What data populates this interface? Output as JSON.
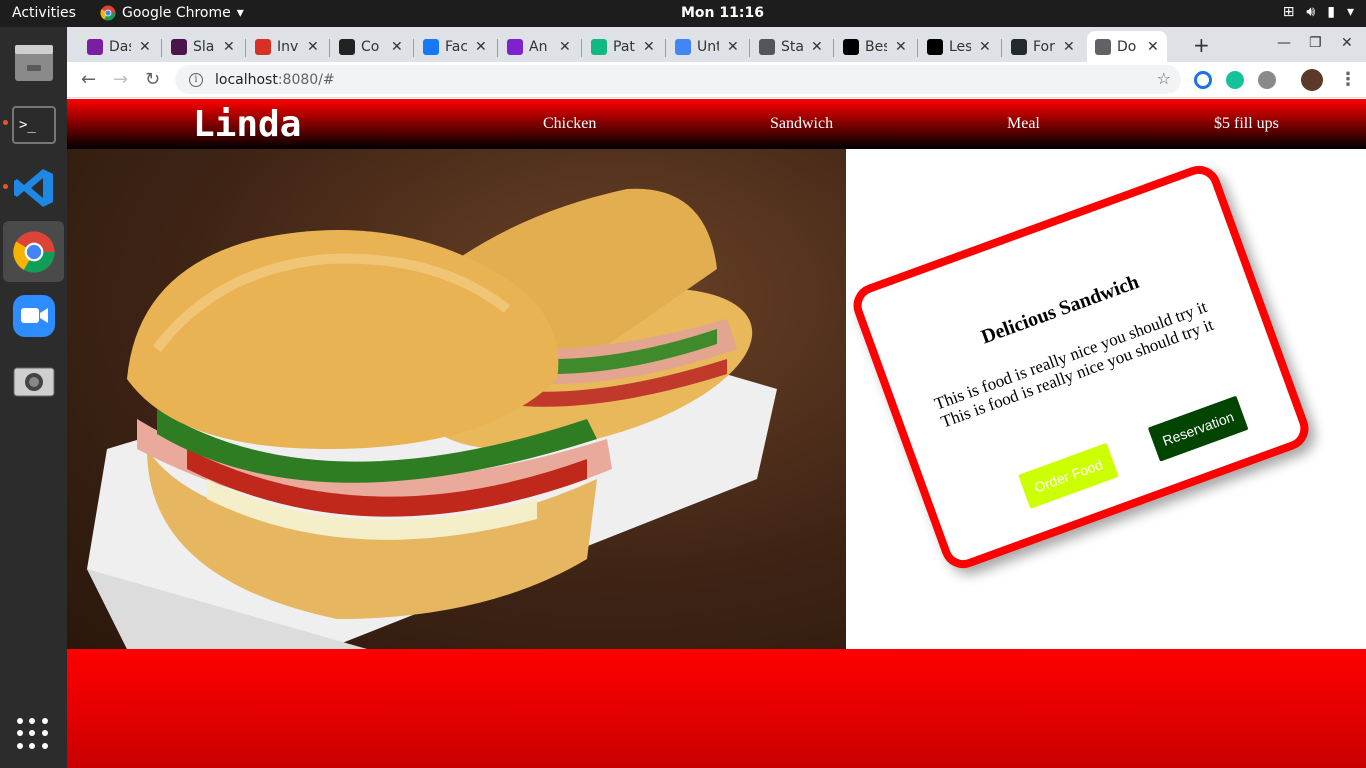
{
  "system": {
    "activities": "Activities",
    "app_name": "Google Chrome",
    "clock": "Mon 11:16"
  },
  "browser": {
    "tabs": [
      {
        "label": "Das",
        "icon": "purple-logo-icon",
        "color": "#7b1fa2"
      },
      {
        "label": "Sla",
        "icon": "slack-icon",
        "color": "#4a154b"
      },
      {
        "label": "Inv",
        "icon": "gmail-icon",
        "color": "#d93025"
      },
      {
        "label": "Co",
        "icon": "codecademy-icon",
        "color": "#222222"
      },
      {
        "label": "Fac",
        "icon": "facebook-icon",
        "color": "#1877f2"
      },
      {
        "label": "An",
        "icon": "django-icon",
        "color": "#7e22ce"
      },
      {
        "label": "Pat",
        "icon": "shield-icon",
        "color": "#10b981"
      },
      {
        "label": "Unt",
        "icon": "docs-icon",
        "color": "#4285f4"
      },
      {
        "label": "Sta",
        "icon": "peace-hand-icon",
        "color": "#555555"
      },
      {
        "label": "Bes",
        "icon": "medium-icon",
        "color": "#000000"
      },
      {
        "label": "Les",
        "icon": "medium-icon",
        "color": "#000000"
      },
      {
        "label": "For",
        "icon": "github-icon",
        "color": "#24292e"
      },
      {
        "label": "Do",
        "icon": "globe-icon",
        "color": "#5f6368",
        "active": true
      }
    ],
    "url_host": "localhost",
    "url_rest": ":8080/#"
  },
  "site": {
    "brand": "Linda",
    "nav": [
      "Chicken",
      "Sandwich",
      "Meal",
      "$5 fill ups"
    ],
    "card": {
      "title": "Delicious Sandwich",
      "text": "This is food is really nice you should try it This is food is really nice you should try it",
      "order_label": "Order Food",
      "reserve_label": "Reservation"
    },
    "colors": {
      "accent": "#ff0000",
      "order": "#ccff00",
      "reserve": "#004400"
    }
  }
}
